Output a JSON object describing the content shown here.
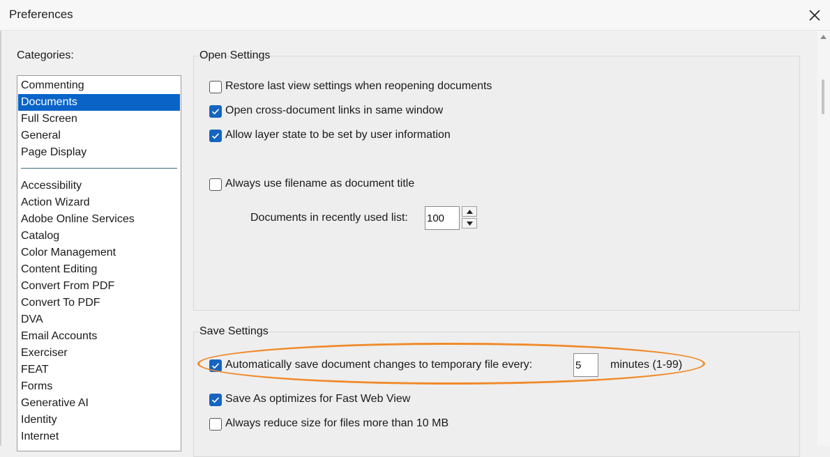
{
  "window": {
    "title": "Preferences",
    "close_icon": "close-icon"
  },
  "categories": {
    "label": "Categories:",
    "top_items": [
      {
        "label": "Commenting",
        "selected": false
      },
      {
        "label": "Documents",
        "selected": true
      },
      {
        "label": "Full Screen",
        "selected": false
      },
      {
        "label": "General",
        "selected": false
      },
      {
        "label": "Page Display",
        "selected": false
      }
    ],
    "items": [
      "Accessibility",
      "Action Wizard",
      "Adobe Online Services",
      "Catalog",
      "Color Management",
      "Content Editing",
      "Convert From PDF",
      "Convert To PDF",
      "DVA",
      "Email Accounts",
      "Exerciser",
      "FEAT",
      "Forms",
      "Generative AI",
      "Identity",
      "Internet"
    ]
  },
  "open_settings": {
    "label": "Open Settings",
    "restore_view": {
      "label": "Restore last view settings when reopening documents",
      "checked": false
    },
    "cross_doc_links": {
      "label": "Open cross-document links in same window",
      "checked": true
    },
    "layer_state": {
      "label": "Allow layer state to be set by user information",
      "checked": true
    },
    "filename_title": {
      "label": "Always use filename as document title",
      "checked": false
    },
    "recent_list": {
      "label": "Documents in recently used list:",
      "value": "100"
    }
  },
  "save_settings": {
    "label": "Save Settings",
    "auto_save": {
      "label": "Automatically save document changes to temporary file every:",
      "checked": true,
      "value": "5",
      "suffix": "minutes (1-99)"
    },
    "fast_web_view": {
      "label": "Save As optimizes for Fast Web View",
      "checked": true
    },
    "reduce_size": {
      "label": "Always reduce size for files more than 10 MB",
      "checked": false
    }
  },
  "colors": {
    "selection": "#0a64c8",
    "checkbox_checked": "#1565c0",
    "highlight_ring": "#f08a2a"
  }
}
